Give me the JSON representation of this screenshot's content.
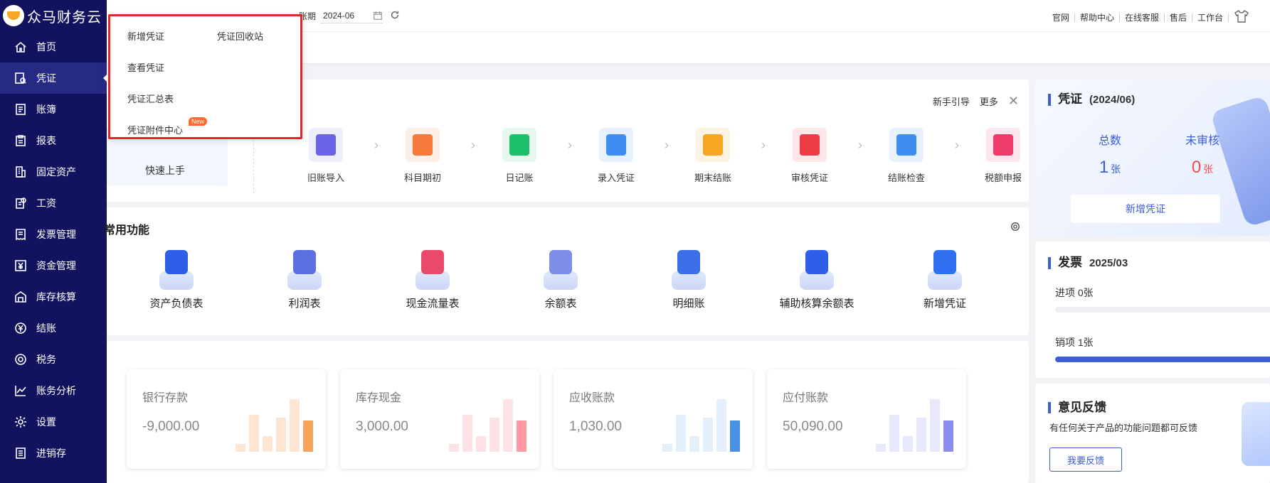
{
  "app": {
    "name": "众马财务云"
  },
  "sidebar": {
    "items": [
      {
        "label": "首页",
        "icon": "home-icon"
      },
      {
        "label": "凭证",
        "icon": "voucher-search-icon",
        "active": true
      },
      {
        "label": "账簿",
        "icon": "ledger-icon"
      },
      {
        "label": "报表",
        "icon": "report-icon"
      },
      {
        "label": "固定资产",
        "icon": "building-icon"
      },
      {
        "label": "工资",
        "icon": "salary-icon"
      },
      {
        "label": "发票管理",
        "icon": "invoice-icon"
      },
      {
        "label": "资金管理",
        "icon": "yen-icon"
      },
      {
        "label": "库存核算",
        "icon": "warehouse-icon"
      },
      {
        "label": "结账",
        "icon": "yen-circle-icon"
      },
      {
        "label": "税务",
        "icon": "tax-icon"
      },
      {
        "label": "账务分析",
        "icon": "chart-line-icon"
      },
      {
        "label": "设置",
        "icon": "gear-icon"
      },
      {
        "label": "进销存",
        "icon": "inventory-icon"
      }
    ]
  },
  "topbar": {
    "period_label": "账期",
    "period_value": "2024-06",
    "links": [
      "官网",
      "帮助中心",
      "在线客服",
      "售后",
      "工作台"
    ]
  },
  "dropdown": {
    "items": [
      "新增凭证",
      "凭证回收站",
      "查看凭证",
      "凭证汇总表",
      "凭证附件中心"
    ],
    "badge": "New"
  },
  "quick": {
    "guide": "新手引导",
    "more": "更多",
    "start": "快速上手",
    "steps": [
      {
        "label": "旧账导入",
        "color": "#6b63e6",
        "bg": "#eeedfc"
      },
      {
        "label": "科目期初",
        "color": "#f5793b",
        "bg": "#fdeee6"
      },
      {
        "label": "日记账",
        "color": "#1ebf6b",
        "bg": "#e6f7ee"
      },
      {
        "label": "录入凭证",
        "color": "#3d8ef0",
        "bg": "#e7f1fd"
      },
      {
        "label": "期末结账",
        "color": "#f5a623",
        "bg": "#fdf3e2"
      },
      {
        "label": "审核凭证",
        "color": "#ee3b48",
        "bg": "#fde7e8"
      },
      {
        "label": "结账检查",
        "color": "#3d8ef0",
        "bg": "#e7f1fd"
      },
      {
        "label": "税额申报",
        "color": "#ee3b6c",
        "bg": "#fde7ee"
      }
    ]
  },
  "common": {
    "title": "常用功能",
    "items": [
      {
        "label": "资产负债表",
        "color": "#2f5ee8"
      },
      {
        "label": "利润表",
        "color": "#5b6fe0"
      },
      {
        "label": "现金流量表",
        "color": "#e94a6b"
      },
      {
        "label": "余额表",
        "color": "#7d8de8"
      },
      {
        "label": "明细账",
        "color": "#3d6ee8"
      },
      {
        "label": "辅助核算余额表",
        "color": "#2f5ee8"
      },
      {
        "label": "新增凭证",
        "color": "#2f6ff0"
      }
    ]
  },
  "stats": [
    {
      "title": "银行存款",
      "value": "-9,000.00",
      "color": "#f6a45b",
      "light": "#fde7d4"
    },
    {
      "title": "库存现金",
      "value": "3,000.00",
      "color": "#ff9aa2",
      "light": "#fde3e5"
    },
    {
      "title": "应收账款",
      "value": "1,030.00",
      "color": "#4a90e2",
      "light": "#e3eefb"
    },
    {
      "title": "应付账款",
      "value": "50,090.00",
      "color": "#8b8ef0",
      "light": "#e8e8fc"
    }
  ],
  "voucher_card": {
    "title": "凭证",
    "period": "(2024/06)",
    "total_label": "总数",
    "total_value": "1",
    "unaudited_label": "未审核",
    "unaudited_value": "0",
    "unit": "张",
    "button": "新增凭证",
    "accent": "#3d5cd6",
    "alert": "#f24b4b"
  },
  "invoice_card": {
    "title": "发票",
    "period": "2025/03",
    "income_label": "进项 0张",
    "income_fraction": 0,
    "output_label": "销项 1张",
    "output_fraction": 1
  },
  "feedback_card": {
    "title": "意见反馈",
    "desc": "有任何关于产品的功能问题都可反馈",
    "button": "我要反馈"
  }
}
